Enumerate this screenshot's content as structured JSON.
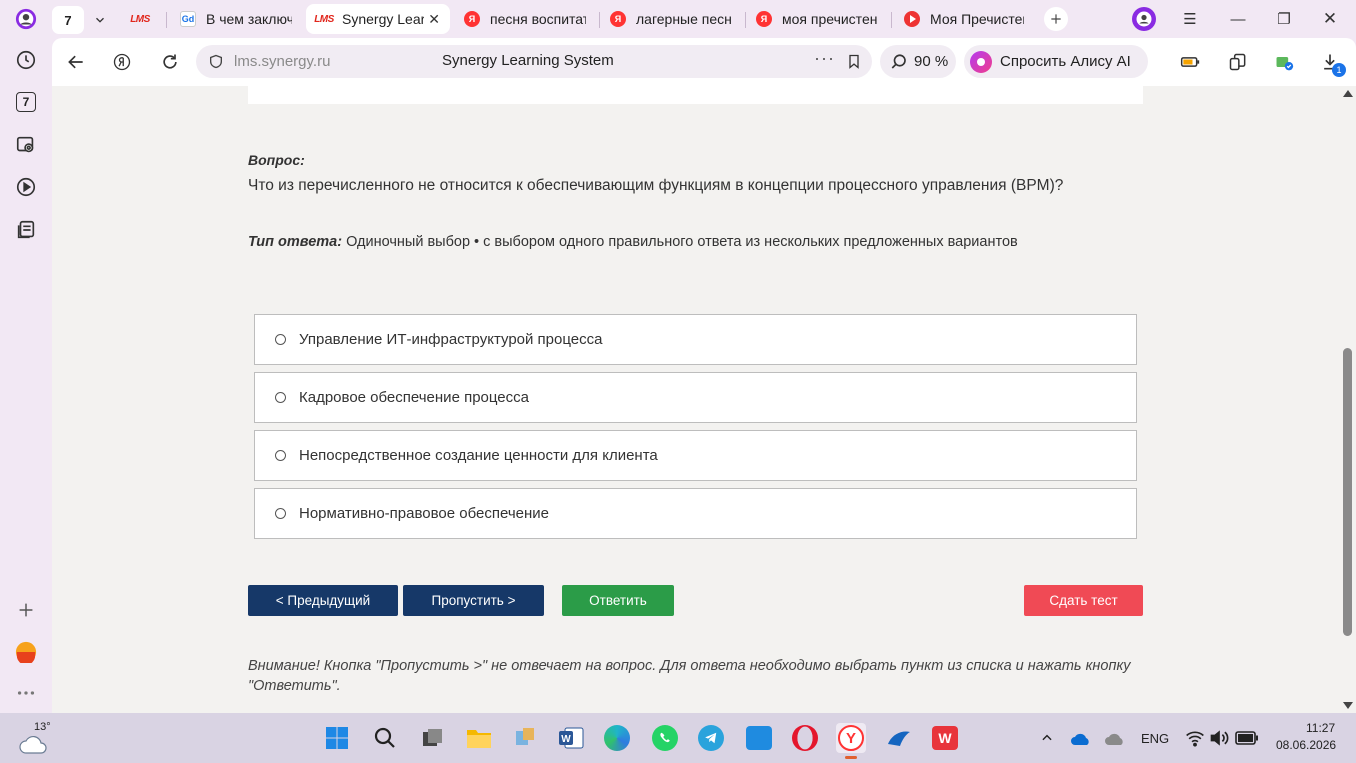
{
  "browser": {
    "tab_count_badge": "7",
    "tabs": [
      {
        "title": "",
        "favicon": "lms",
        "active": false
      },
      {
        "title": "В чем заключа",
        "favicon": "google-docs",
        "active": false
      },
      {
        "title": "Synergy Learn",
        "favicon": "lms",
        "active": true
      },
      {
        "title": "песня воспитат",
        "favicon": "yandex",
        "active": false
      },
      {
        "title": "лагерные песн",
        "favicon": "yandex",
        "active": false
      },
      {
        "title": "моя пречистен",
        "favicon": "yandex",
        "active": false
      },
      {
        "title": "Моя Пречистен",
        "favicon": "video",
        "active": false
      }
    ],
    "url": "lms.synergy.ru",
    "page_title": "Synergy Learning System",
    "zoom": "90 %",
    "alice_label": "Спросить Алису AI",
    "sidebar_badge": "7",
    "downloads_badge": "1"
  },
  "quiz": {
    "question_label": "Вопрос:",
    "question_text": "Что из перечисленного не относится к обеспечивающим функциям в концепции процессного управления (BPM)?",
    "answer_type_label": "Тип ответа:",
    "answer_type_value": " Одиночный выбор • с выбором одного правильного ответа из нескольких предложенных вариантов",
    "options": [
      "Управление ИТ-инфраструктурой процесса",
      "Кадровое обеспечение процесса",
      "Непосредственное создание ценности для клиента",
      "Нормативно-правовое обеспечение"
    ],
    "buttons": {
      "prev": "< Предыдущий",
      "skip": "Пропустить >",
      "answer": "Ответить",
      "submit": "Сдать тест"
    },
    "notice": "Внимание! Кнопка \"Пропустить >\" не отвечает на вопрос. Для ответа необходимо выбрать пункт из списка и нажать кнопку \"Ответить\"."
  },
  "taskbar": {
    "weather_temp": "13°",
    "language": "ENG",
    "time": "11:27",
    "date": "08.06.2026"
  },
  "colors": {
    "primary_button": "#163868",
    "answer_button": "#2b9c48",
    "submit_button": "#f04a55",
    "page_background": "#f3f2f0",
    "browser_chrome": "#f2e8f4"
  }
}
